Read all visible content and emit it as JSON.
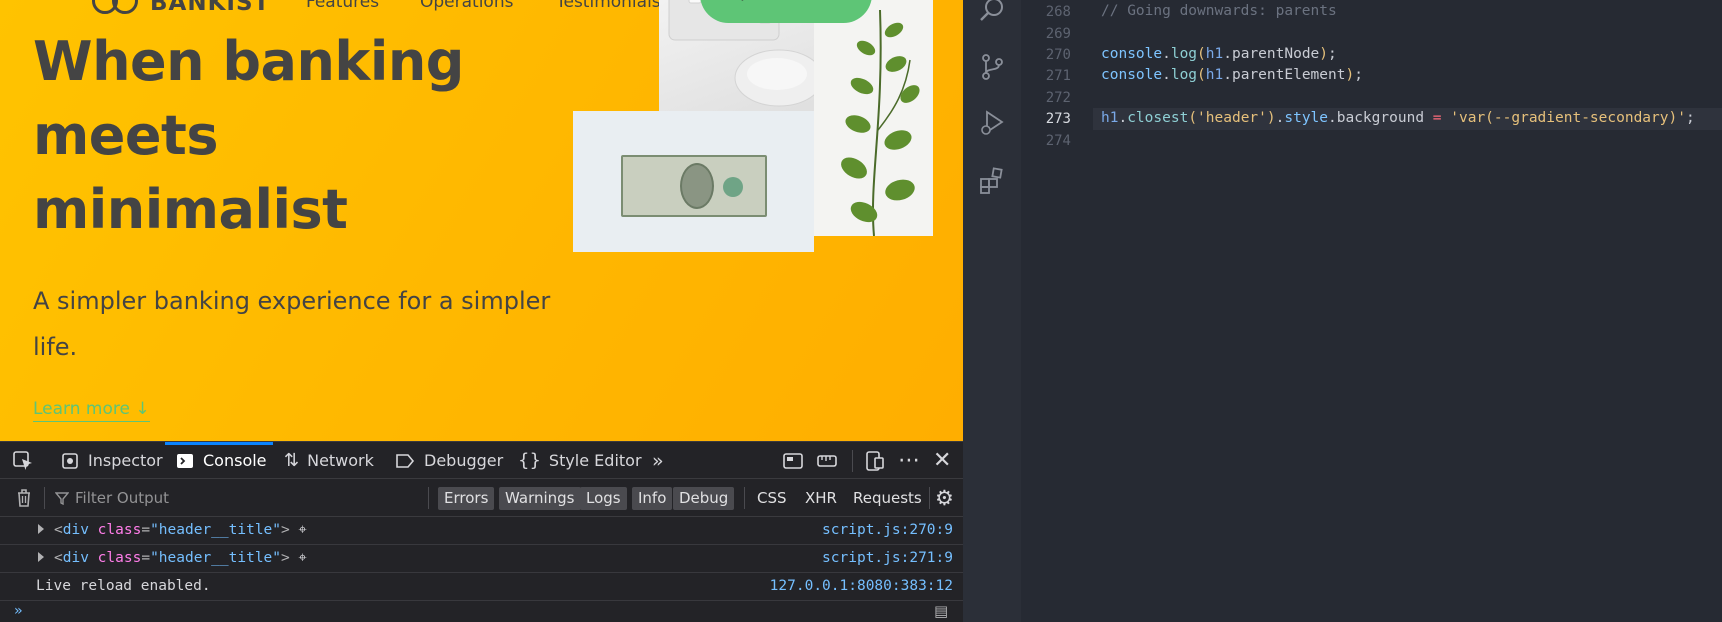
{
  "site": {
    "logo_text": "BANKIST",
    "nav": [
      "Features",
      "Operations",
      "Testimonials"
    ],
    "open_account": "Open account",
    "hero_title": "When banking meets minimalist",
    "hero_subtitle": "A simpler banking experience for a simpler life.",
    "learn_more": "Learn more ↓"
  },
  "devtools": {
    "tabs": [
      {
        "label": "Inspector",
        "icon": "inspector-icon"
      },
      {
        "label": "Console",
        "icon": "console-icon",
        "active": true
      },
      {
        "label": "Network",
        "icon": "network-icon"
      },
      {
        "label": "Debugger",
        "icon": "debugger-icon"
      },
      {
        "label": "Style Editor",
        "icon": "style-editor-icon"
      }
    ],
    "filter_placeholder": "Filter Output",
    "levels": [
      "Errors",
      "Warnings",
      "Logs",
      "Info",
      "Debug"
    ],
    "types": [
      "CSS",
      "XHR",
      "Requests"
    ],
    "messages": [
      {
        "tag_open": "<",
        "tag": "div",
        "attr": "class",
        "value": "\"header__title\"",
        "tag_close": ">",
        "source": "script.js:270:9"
      },
      {
        "tag_open": "<",
        "tag": "div",
        "attr": "class",
        "value": "\"header__title\"",
        "tag_close": ">",
        "source": "script.js:271:9"
      },
      {
        "text": "Live reload enabled.",
        "source": "127.0.0.1:8080:383:12"
      }
    ],
    "prompt": "»"
  },
  "editor": {
    "lines": [
      {
        "n": "268",
        "code": "// Going downwards: parents"
      },
      {
        "n": "269",
        "code": ""
      },
      {
        "n": "270",
        "code": "console.log(h1.parentNode);"
      },
      {
        "n": "271",
        "code": "console.log(h1.parentElement);"
      },
      {
        "n": "272",
        "code": ""
      },
      {
        "n": "273",
        "code": "h1.closest('header').style.background = 'var(--gradient-secondary)';",
        "current": true
      },
      {
        "n": "274",
        "code": ""
      }
    ]
  },
  "colors": {
    "accent": "#5ec576",
    "hero_bg": "#ffb900",
    "devtools_bg": "#232327",
    "editor_bg": "#262a33",
    "link_blue": "#75bfff"
  }
}
